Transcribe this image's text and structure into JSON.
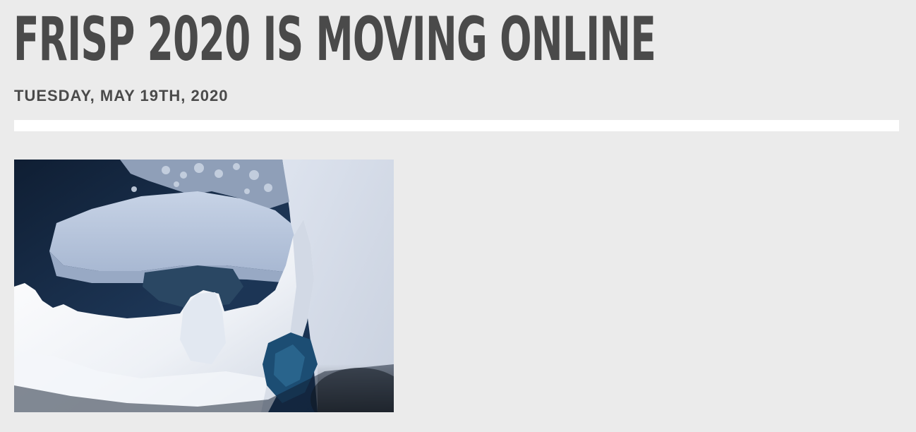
{
  "post": {
    "title": "FRISP 2020 IS MOVING ONLINE",
    "date": "TUESDAY, MAY 19TH, 2020"
  },
  "image": {
    "subject": "iceberg-photo"
  },
  "colors": {
    "background": "#ebebeb",
    "text": "#4a4a4a",
    "divider": "#ffffff"
  }
}
